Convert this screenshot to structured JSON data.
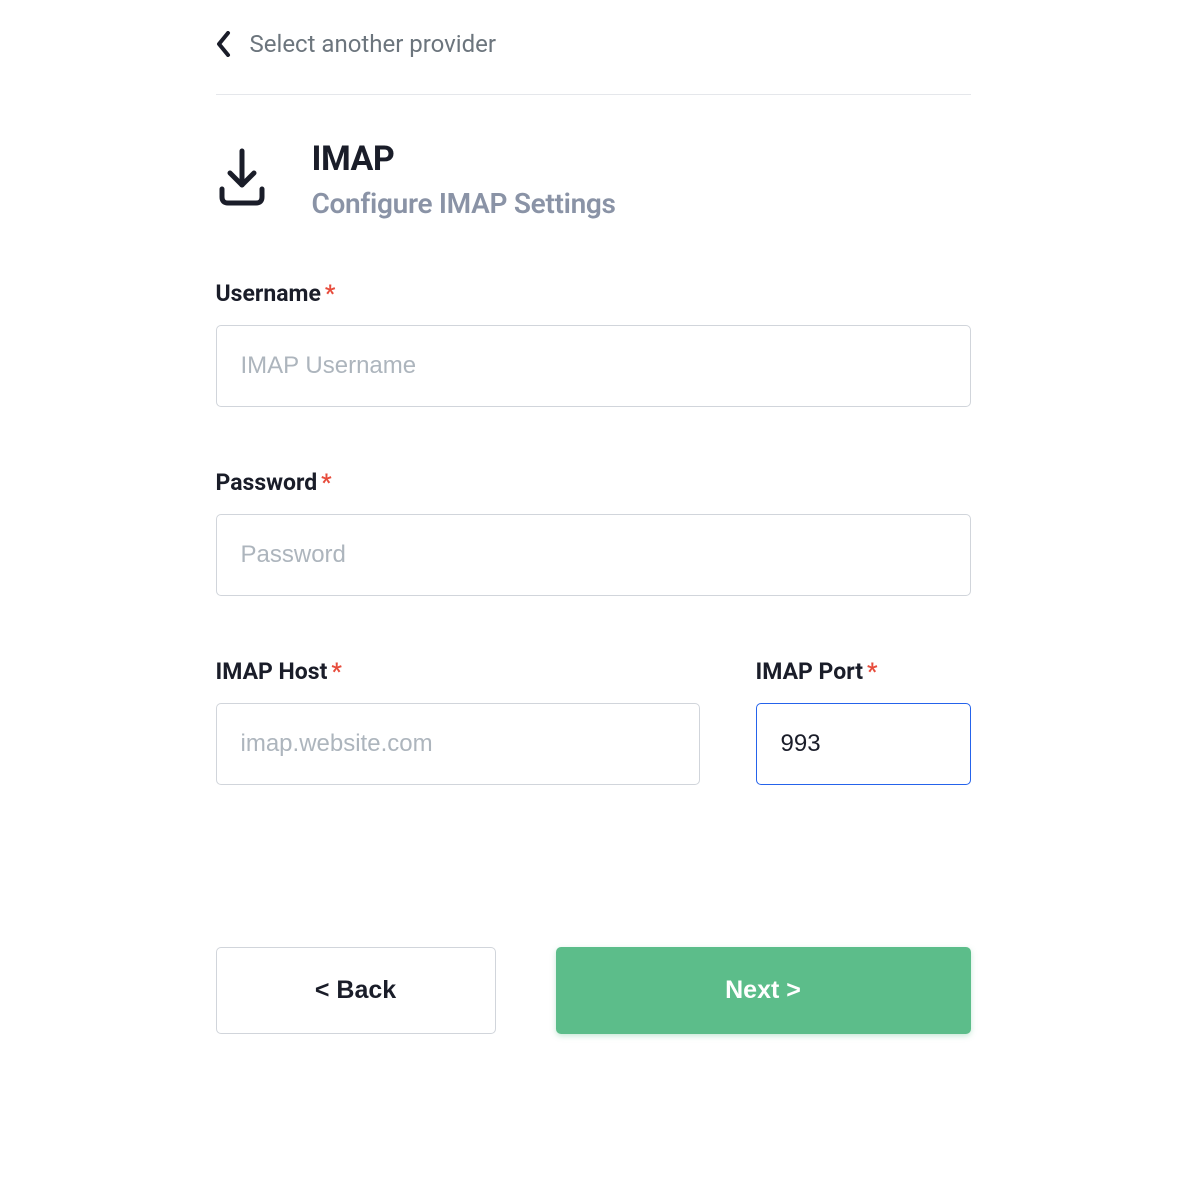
{
  "header": {
    "back_link": "Select another provider",
    "title": "IMAP",
    "subtitle": "Configure IMAP Settings"
  },
  "fields": {
    "username": {
      "label": "Username",
      "placeholder": "IMAP Username",
      "value": ""
    },
    "password": {
      "label": "Password",
      "placeholder": "Password",
      "value": ""
    },
    "host": {
      "label": "IMAP Host",
      "placeholder": "imap.website.com",
      "value": ""
    },
    "port": {
      "label": "IMAP Port",
      "placeholder": "",
      "value": "993"
    }
  },
  "buttons": {
    "back": "< Back",
    "next": "Next >"
  },
  "required_marker": "*"
}
